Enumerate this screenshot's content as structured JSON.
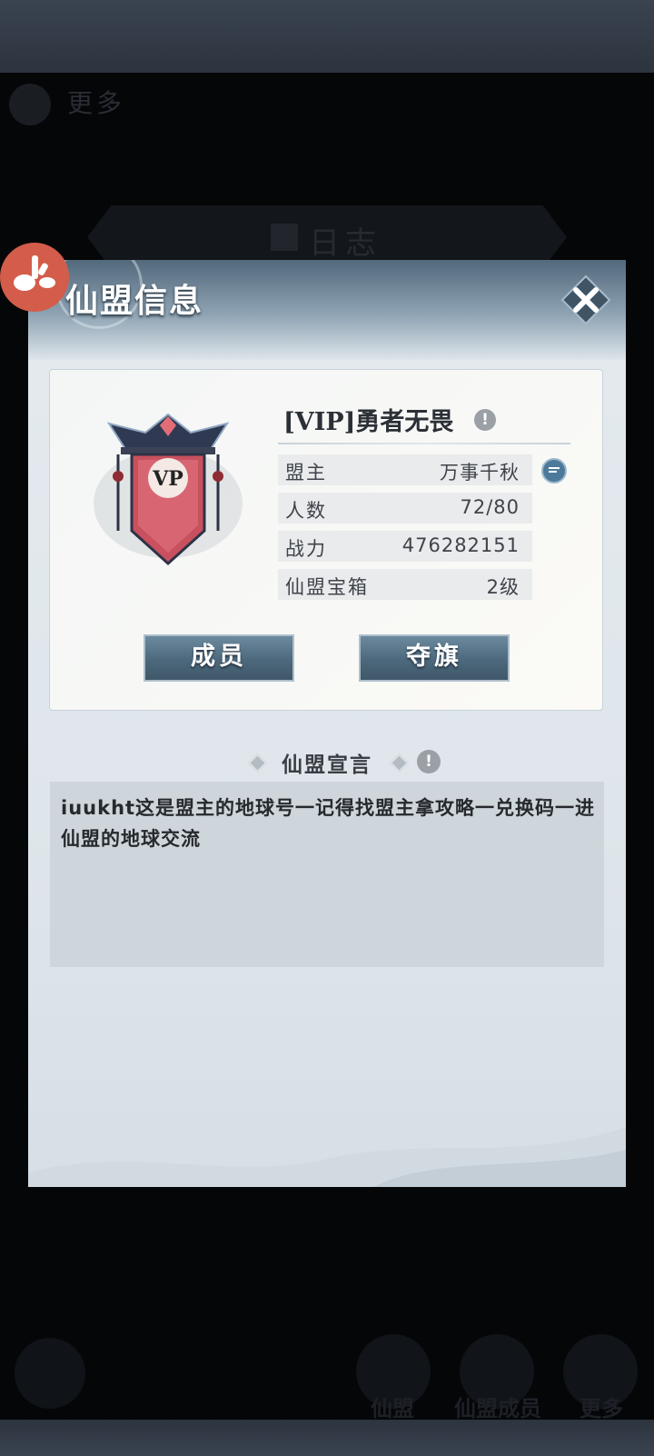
{
  "background": {
    "more_title": "更多",
    "log_title": "日志",
    "nav_items": [
      {
        "label": "仙盟"
      },
      {
        "label": "仙盟成员"
      },
      {
        "label": "更多"
      }
    ]
  },
  "dialog": {
    "title": "仙盟信息",
    "guild": {
      "emblem_text": "VP",
      "name": "[VIP]勇者无畏",
      "stats": [
        {
          "label": "盟主",
          "value": "万事千秋"
        },
        {
          "label": "人数",
          "value": "72/80"
        },
        {
          "label": "战力",
          "value": "476282151"
        },
        {
          "label": "仙盟宝箱",
          "value": "2级"
        }
      ]
    },
    "buttons": {
      "members": "成员",
      "flag": "夺旗"
    },
    "declaration": {
      "title": "仙盟宣言",
      "text": "iuukht这是盟主的地球号一记得找盟主拿攻略一兑换码一进仙盟的地球交流"
    }
  },
  "colors": {
    "dialog_bg": "#e4eaee",
    "header": "#52697c",
    "button": "#4d687c",
    "float_logo": "#d35d4a"
  }
}
